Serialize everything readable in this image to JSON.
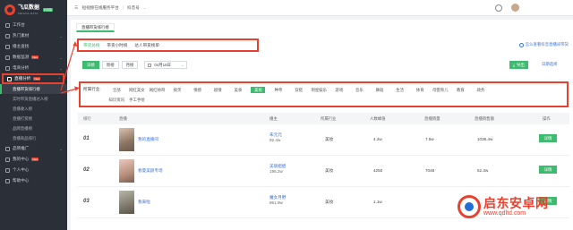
{
  "app": {
    "logo_title": "飞瓜数据",
    "logo_sub": "FEIGUA DATA",
    "logo_badge": "抖音版"
  },
  "sidebar": {
    "items": [
      {
        "label": "工作台"
      },
      {
        "label": "热门素材"
      },
      {
        "label": "播主查找"
      },
      {
        "label": "数据监测",
        "badge": "New"
      },
      {
        "label": "电商分析"
      },
      {
        "label": "直播分析",
        "badge": "New"
      },
      {
        "label": "品牌推广"
      },
      {
        "label": "我的中心",
        "badge": "New"
      },
      {
        "label": "个人中心"
      },
      {
        "label": "帮助中心"
      }
    ],
    "live_sub": [
      {
        "label": "直播带货排行榜"
      },
      {
        "label": "实时带货直播达人榜"
      },
      {
        "label": "直播收入榜"
      },
      {
        "label": "直播打赏榜"
      },
      {
        "label": "品牌直播榜"
      },
      {
        "label": "直播商品排行"
      }
    ]
  },
  "topbar": {
    "breadcrumb": "短视频在线服务平台",
    "account": "抖音号"
  },
  "page_tab": "直播带货排行榜",
  "rank_tabs": [
    {
      "label": "带货总榜"
    },
    {
      "label": "带货小时榜"
    },
    {
      "label": "达人带货榜单"
    }
  ],
  "help_link": "怎么查看抖音直播间带货",
  "filters": {
    "day": "日榜",
    "week": "周榜",
    "month": "月榜",
    "date": "04月16日",
    "export": "导出",
    "date_link": "日期选择"
  },
  "categories": {
    "label": "所属行业:",
    "row1": [
      "全部",
      "网红美女",
      "网红帅哥",
      "搞笑",
      "情感",
      "剧情",
      "美食",
      "美妆",
      "种草",
      "穿搭",
      "明星娱乐",
      "游戏",
      "音乐",
      "舞蹈",
      "生活",
      "体育",
      "母婴育儿",
      "教育",
      "政务"
    ],
    "row2": [
      "知识资讯",
      "手工手绘"
    ],
    "active": "美妆"
  },
  "table": {
    "headers": {
      "rank": "排行",
      "live": "直播",
      "anchor": "播主",
      "industry": "所属行业",
      "viewers": "人数峰值",
      "sales": "直播销量",
      "gmv": "直播销售额",
      "ops": "操作"
    },
    "rows": [
      {
        "rank": "01",
        "title": "我的直播间",
        "anchor": "朱元元",
        "fans": "92.4w",
        "industry": "美妆",
        "viewers": "4.2w",
        "sales": "7.5w",
        "gmv": "1036.4w",
        "action": "详情"
      },
      {
        "rank": "02",
        "title": "春夏美颜专场",
        "anchor": "美丽姐姐",
        "fans": "195.2w",
        "industry": "美妆",
        "viewers": "4250",
        "sales": "7048",
        "gmv": "52.3w",
        "action": "详情"
      },
      {
        "rank": "03",
        "title": "我来啦",
        "anchor": "魔女月野",
        "fans": "951.9w",
        "industry": "美妆",
        "viewers": "1.1w",
        "sales": "",
        "gmv": "",
        "action": "详情"
      }
    ]
  },
  "watermark": {
    "title": "启东安卓网",
    "url": "www.qdltd.com"
  },
  "colors": {
    "accent": "#3dbb6e",
    "annotation": "#e8412f",
    "link": "#3b73d9",
    "sidebar": "#2b2f38"
  }
}
